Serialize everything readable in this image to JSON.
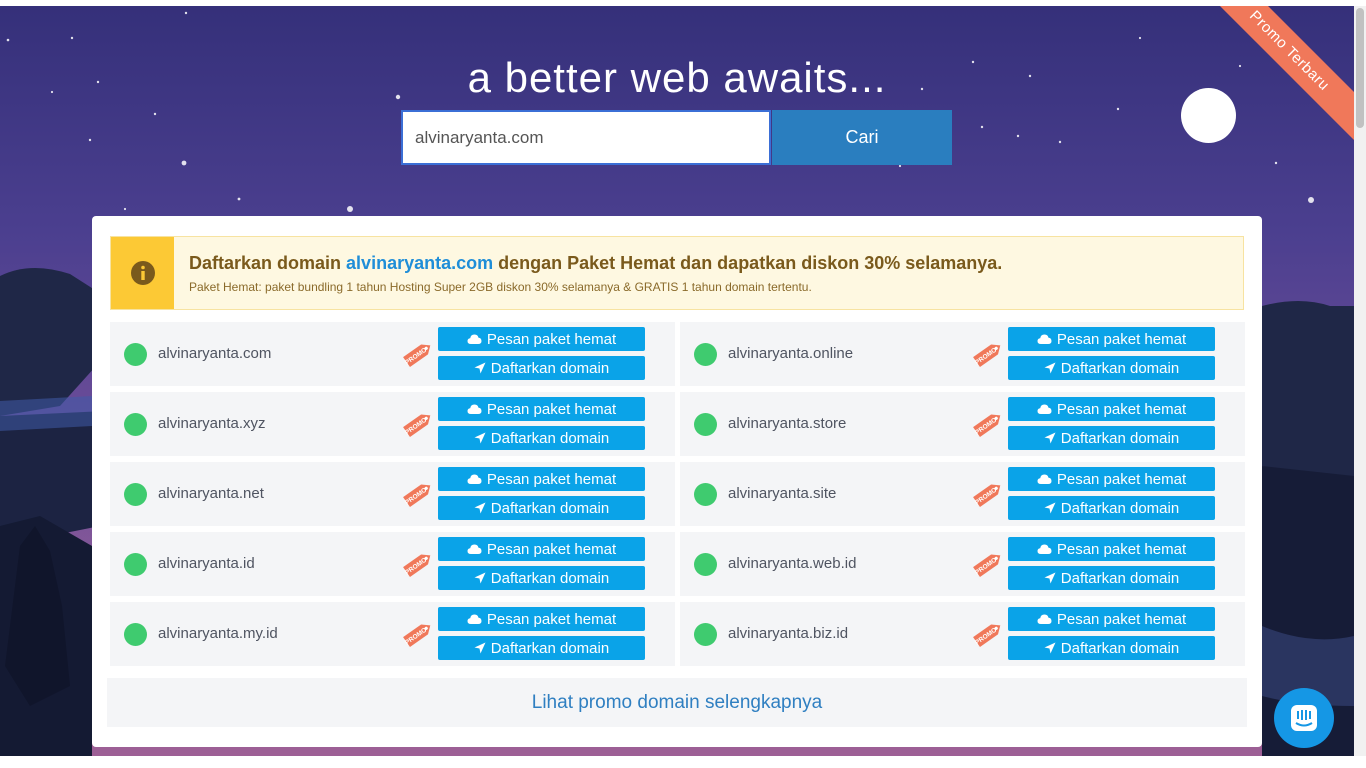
{
  "hero": {
    "headline": "a better web awaits...",
    "ribbon": "Promo Terbaru",
    "search_value": "alvinaryanta.com",
    "search_button": "Cari"
  },
  "notice": {
    "icon": "info-icon",
    "title_prefix": "Daftarkan domain ",
    "title_domain": "alvinaryanta.com",
    "title_suffix": " dengan Paket Hemat dan dapatkan diskon 30% selamanya.",
    "subtitle": "Paket Hemat: paket bundling 1 tahun Hosting Super 2GB diskon 30% selamanya & GRATIS 1 tahun domain tertentu."
  },
  "domains": [
    {
      "name": "alvinaryanta.com"
    },
    {
      "name": "alvinaryanta.online"
    },
    {
      "name": "alvinaryanta.xyz"
    },
    {
      "name": "alvinaryanta.store"
    },
    {
      "name": "alvinaryanta.net"
    },
    {
      "name": "alvinaryanta.site"
    },
    {
      "name": "alvinaryanta.id"
    },
    {
      "name": "alvinaryanta.web.id"
    },
    {
      "name": "alvinaryanta.my.id"
    },
    {
      "name": "alvinaryanta.biz.id"
    }
  ],
  "buttons": {
    "order_bundle": "Pesan paket hemat",
    "register_domain": "Daftarkan domain",
    "promo_tag": "PROMO"
  },
  "more_link": "Lihat promo domain selengkapnya",
  "colors": {
    "accent": "#0aa3e8",
    "available": "#3fcb6f",
    "notice_bg": "#fef8e1",
    "ribbon": "#f0785a"
  }
}
